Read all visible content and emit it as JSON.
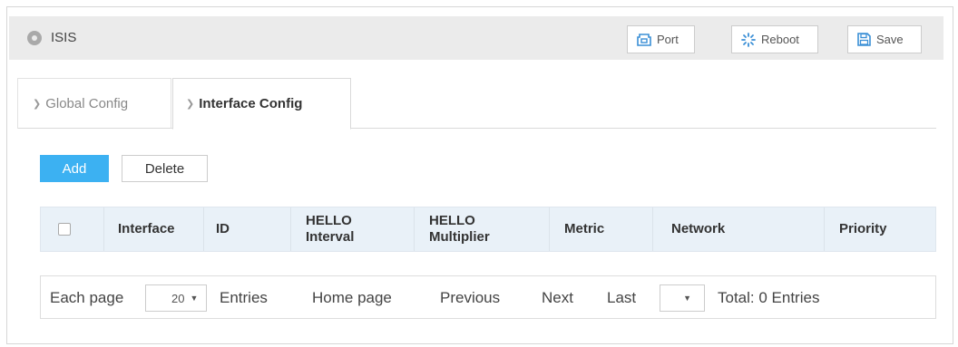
{
  "header": {
    "title": "ISIS",
    "buttons": {
      "port": "Port",
      "reboot": "Reboot",
      "save": "Save"
    }
  },
  "tabs": [
    {
      "label": "Global Config",
      "active": false
    },
    {
      "label": "Interface Config",
      "active": true
    }
  ],
  "actions": {
    "add": "Add",
    "delete": "Delete"
  },
  "table": {
    "columns": [
      "Interface",
      "ID",
      "HELLO Interval",
      "HELLO Multiplier",
      "Metric",
      "Network",
      "Priority"
    ],
    "rows": []
  },
  "pagination": {
    "each_page": "Each page",
    "page_size": "20",
    "entries": "Entries",
    "home_page": "Home page",
    "previous": "Previous",
    "next": "Next",
    "last": "Last",
    "page_select": "",
    "total": "Total: 0 Entries"
  },
  "colors": {
    "accent": "#3cb1f2",
    "header_bg": "#ebebeb",
    "table_header_bg": "#e9f1f8"
  },
  "icons": {
    "title": "circle-icon",
    "port": "port-icon",
    "reboot": "spinner-icon",
    "save": "floppy-icon"
  }
}
